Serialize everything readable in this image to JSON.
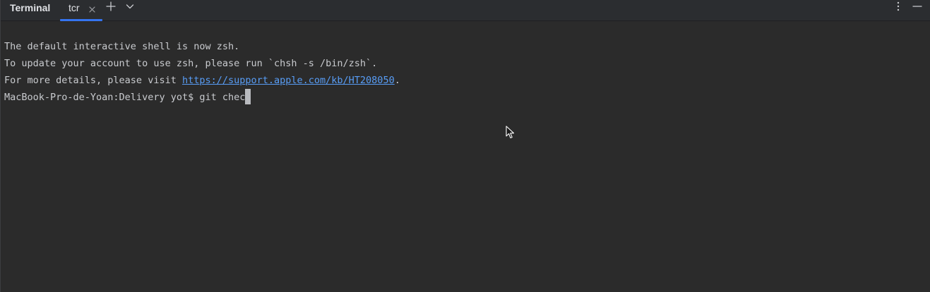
{
  "header": {
    "panel_title": "Terminal",
    "tabs": [
      {
        "label": "tcr",
        "active": true
      }
    ],
    "icons": {
      "close_tab": "close-icon",
      "new_tab": "plus-icon",
      "tab_menu": "chevron-down-icon",
      "options": "more-vertical-icon",
      "hide": "minimize-icon"
    }
  },
  "terminal": {
    "lines": [
      {
        "text": "The default interactive shell is now zsh."
      },
      {
        "text": "To update your account to use zsh, please run `chsh -s /bin/zsh`."
      },
      {
        "prefix": "For more details, please visit ",
        "link": "https://support.apple.com/kb/HT208050",
        "suffix": "."
      },
      {
        "prompt": "MacBook-Pro-de-Yoan:Delivery yot$ ",
        "input": "git chec"
      }
    ]
  },
  "colors": {
    "background": "#2b2b2b",
    "header_background": "#2b2d30",
    "text": "#c9cbcf",
    "link": "#589df6",
    "accent": "#3574f0"
  }
}
